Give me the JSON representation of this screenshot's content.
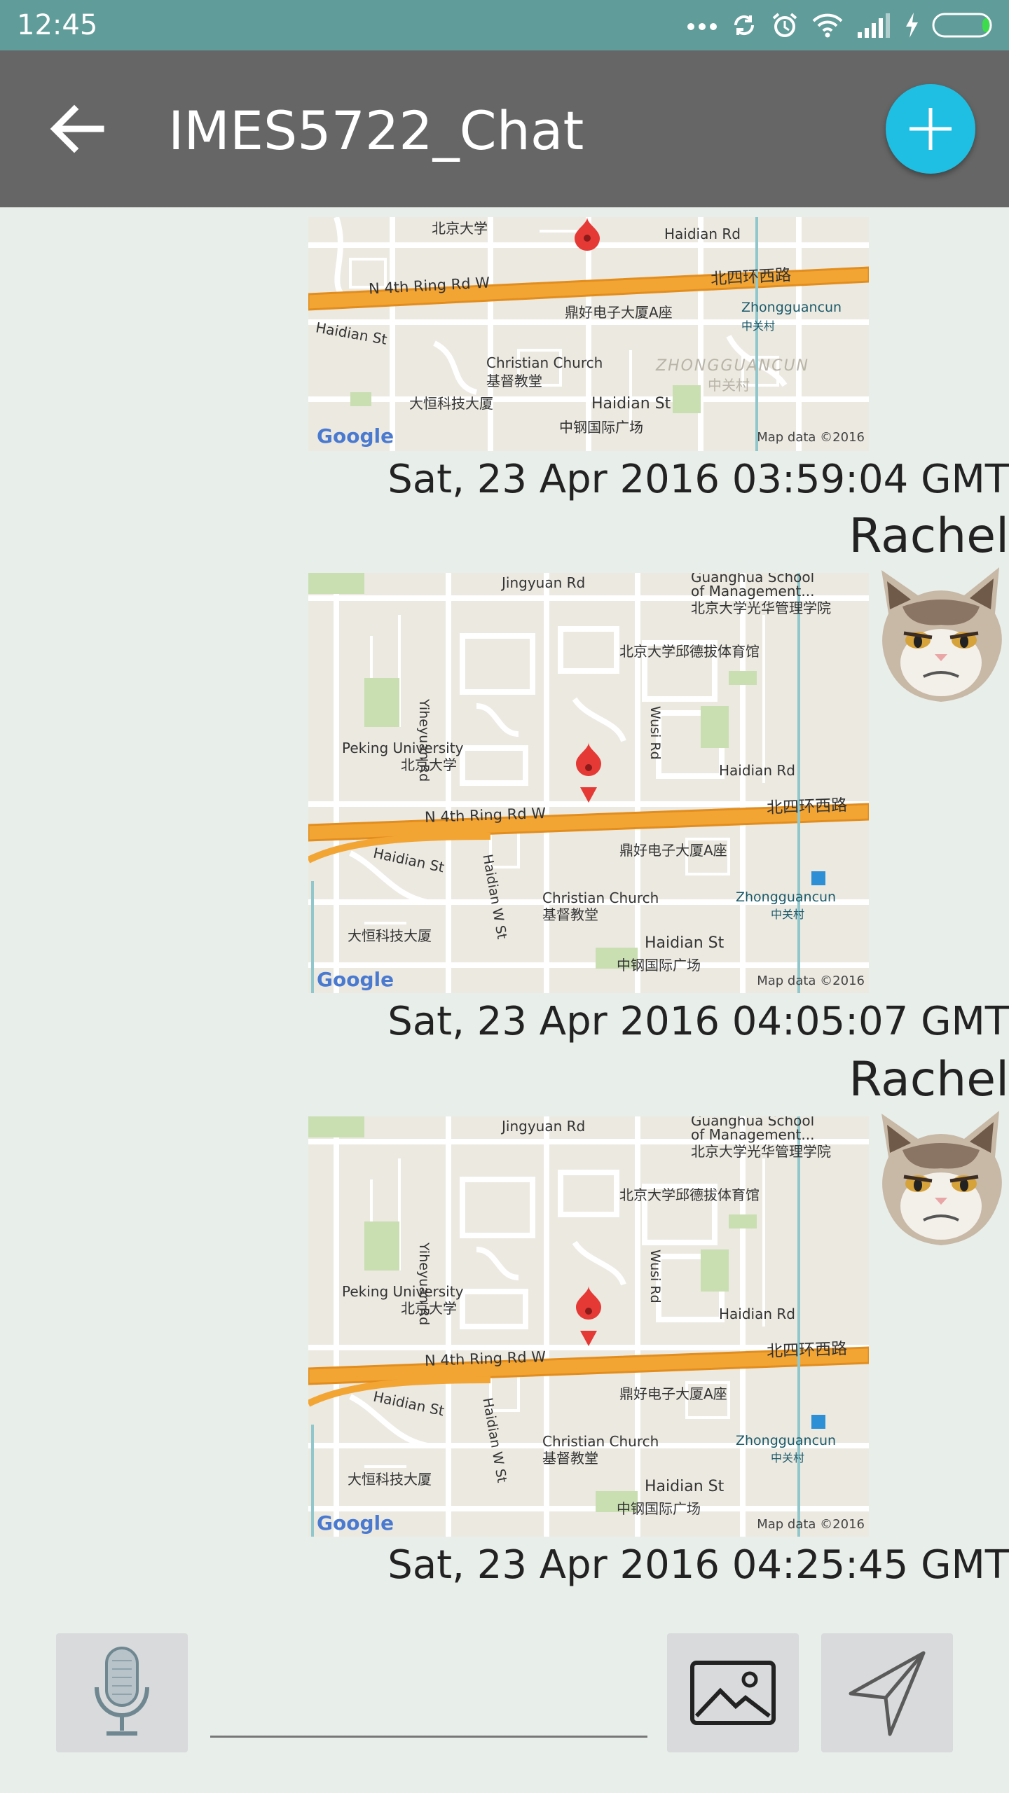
{
  "status_bar": {
    "time": "12:45"
  },
  "app_bar": {
    "title": "IMES5722_Chat"
  },
  "messages": [
    {
      "sender": "",
      "type": "map",
      "timestamp": "Sat, 23 Apr 2016 03:59:04 GMT",
      "map_labels": {
        "top_left": "北京大学",
        "road_right": "Haidian Rd",
        "ring_road_en": "N 4th Ring Rd W",
        "ring_road_cn": "北四环西路",
        "building": "鼎好电子大厦A座",
        "area": "Zhongguancun",
        "area_cn": "中关村",
        "area_big": "ZHONGGUANCUN",
        "area_big_cn": "中关村",
        "street_left": "Haidian St",
        "church": "Christian Church",
        "church_cn": "基督教堂",
        "tech_building": "大恒科技大厦",
        "haidian_st": "Haidian St",
        "plaza": "中钢国际广场",
        "google": "Google",
        "copyright": "Map data ©2016"
      }
    },
    {
      "sender": "Rachel",
      "type": "map",
      "timestamp": "Sat, 23 Apr 2016 04:05:07 GMT",
      "map_labels": {
        "jingyuan": "Jingyuan Rd",
        "guanghua1": "Guanghua School",
        "guanghua2": "of Management...",
        "guanghua_cn": "北京大学光华管理学院",
        "gym": "北京大学邱德拔体育馆",
        "yiheyuan": "Yiheyuan Rd",
        "wusi": "Wusi Rd",
        "peking": "Peking University",
        "peking_cn": "北京大学",
        "road_right": "Haidian Rd",
        "ring_road_en": "N 4th Ring Rd W",
        "ring_road_cn": "北四环西路",
        "building": "鼎好电子大厦A座",
        "street_left": "Haidian St",
        "haidian_w": "Haidian W St",
        "church": "Christian Church",
        "church_cn": "基督教堂",
        "area": "Zhongguancun",
        "area_cn": "中关村",
        "tech_building": "大恒科技大厦",
        "haidian_st": "Haidian St",
        "plaza": "中钢国际广场",
        "google": "Google",
        "copyright": "Map data ©2016"
      }
    },
    {
      "sender": "Rachel",
      "type": "map",
      "timestamp": "Sat, 23 Apr 2016 04:25:45 GMT",
      "map_labels": {
        "jingyuan": "Jingyuan Rd",
        "guanghua1": "Guanghua School",
        "guanghua2": "of Management...",
        "guanghua_cn": "北京大学光华管理学院",
        "gym": "北京大学邱德拔体育馆",
        "yiheyuan": "Yiheyuan Rd",
        "wusi": "Wusi Rd",
        "peking": "Peking University",
        "peking_cn": "北京大学",
        "road_right": "Haidian Rd",
        "ring_road_en": "N 4th Ring Rd W",
        "ring_road_cn": "北四环西路",
        "building": "鼎好电子大厦A座",
        "street_left": "Haidian St",
        "haidian_w": "Haidian W St",
        "church": "Christian Church",
        "church_cn": "基督教堂",
        "area": "Zhongguancun",
        "area_cn": "中关村",
        "tech_building": "大恒科技大厦",
        "haidian_st": "Haidian St",
        "plaza": "中钢国际广场",
        "google": "Google",
        "copyright": "Map data ©2016"
      }
    }
  ],
  "composer": {
    "input_value": "",
    "input_placeholder": ""
  },
  "icons": {
    "back": "arrow-left-icon",
    "fab": "plus-icon",
    "mic": "microphone-icon",
    "image": "image-icon",
    "send": "send-icon",
    "avatar": "cat-avatar"
  },
  "colors": {
    "status_bar": "#5f9c9a",
    "app_bar": "#666666",
    "fab": "#1ebfe3",
    "background": "#e8eeea"
  }
}
